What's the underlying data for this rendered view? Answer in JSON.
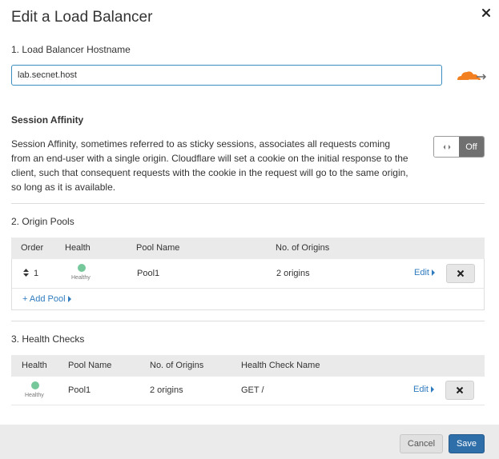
{
  "dialog": {
    "title": "Edit a Load Balancer"
  },
  "hostname": {
    "label": "1. Load Balancer Hostname",
    "value": "lab.secnet.host"
  },
  "session_affinity": {
    "heading": "Session Affinity",
    "description": "Session Affinity, sometimes referred to as sticky sessions, associates all requests coming from an end-user with a single origin. Cloudflare will set a cookie on the initial response to the client, such that consequent requests with the cookie in the request will go to the same origin, so long as it is available.",
    "toggle_state": "Off"
  },
  "origin_pools": {
    "label": "2. Origin Pools",
    "columns": [
      "Order",
      "Health",
      "Pool Name",
      "No. of Origins"
    ],
    "rows": [
      {
        "order": "1",
        "health": "Healthy",
        "pool_name": "Pool1",
        "origins": "2 origins",
        "edit_label": "Edit"
      }
    ],
    "add_label": "+ Add Pool"
  },
  "health_checks": {
    "label": "3. Health Checks",
    "columns": [
      "Health",
      "Pool Name",
      "No. of Origins",
      "Health Check Name"
    ],
    "rows": [
      {
        "health": "Healthy",
        "pool_name": "Pool1",
        "origins": "2 origins",
        "check_name": "GET /",
        "edit_label": "Edit"
      }
    ]
  },
  "footer": {
    "cancel_label": "Cancel",
    "save_label": "Save"
  },
  "colors": {
    "accent": "#2f6fa9",
    "link": "#2f7bbf",
    "healthy": "#76c89b",
    "cloud": "#f38020"
  }
}
